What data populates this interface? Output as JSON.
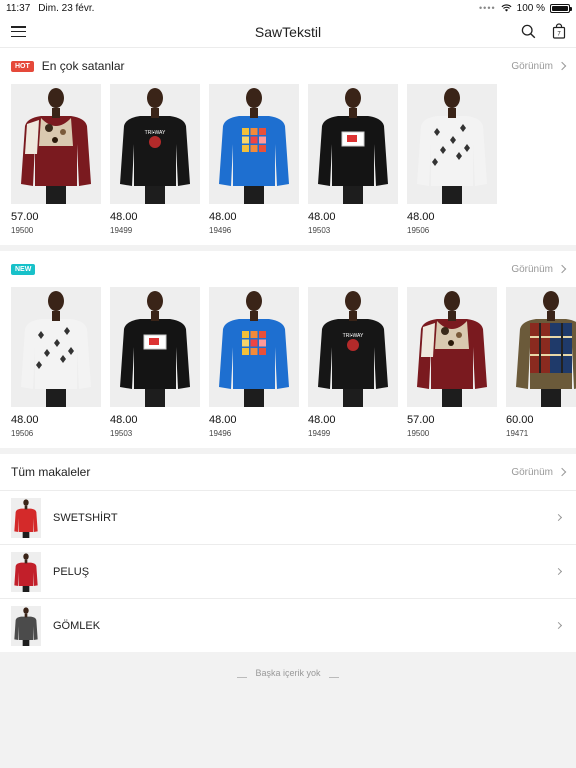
{
  "status_bar": {
    "time": "11:37",
    "date": "Dim. 23 févr.",
    "battery": "100 %",
    "battery_level": 1.0
  },
  "navbar": {
    "title": "SawTekstil"
  },
  "sections": {
    "bestsellers": {
      "badge": "HOT",
      "title": "En çok satanlar",
      "more": "Görünüm",
      "items": [
        {
          "price": "57.00",
          "code": "19500",
          "shirt": "#7a1a1f",
          "style": "fur"
        },
        {
          "price": "48.00",
          "code": "19499",
          "shirt": "#161616",
          "style": "hoodie"
        },
        {
          "price": "48.00",
          "code": "19496",
          "shirt": "#1e6fd0",
          "style": "blocks"
        },
        {
          "price": "48.00",
          "code": "19503",
          "shirt": "#141414",
          "style": "tv"
        },
        {
          "price": "48.00",
          "code": "19506",
          "shirt": "#f3f3f3",
          "style": "pattern"
        }
      ]
    },
    "new": {
      "badge": "NEW",
      "title": "",
      "more": "Görünüm",
      "items": [
        {
          "price": "48.00",
          "code": "19506",
          "shirt": "#f3f3f3",
          "style": "pattern"
        },
        {
          "price": "48.00",
          "code": "19503",
          "shirt": "#141414",
          "style": "tv"
        },
        {
          "price": "48.00",
          "code": "19496",
          "shirt": "#1e6fd0",
          "style": "blocks"
        },
        {
          "price": "48.00",
          "code": "19499",
          "shirt": "#161616",
          "style": "hoodie"
        },
        {
          "price": "57.00",
          "code": "19500",
          "shirt": "#7a1a1f",
          "style": "fur"
        },
        {
          "price": "60.00",
          "code": "19471",
          "shirt": "#6b5a3a",
          "style": "plaid"
        }
      ]
    },
    "articles": {
      "title": "Tüm makaleler",
      "more": "Görünüm",
      "categories": [
        {
          "name": "SWETSHİRT",
          "shirt": "#d42a2a"
        },
        {
          "name": "PELUŞ",
          "shirt": "#c21f2a"
        },
        {
          "name": "GÖMLEK",
          "shirt": "#4b4b4b"
        }
      ]
    }
  },
  "footer": {
    "text": "Başka içerik yok"
  }
}
